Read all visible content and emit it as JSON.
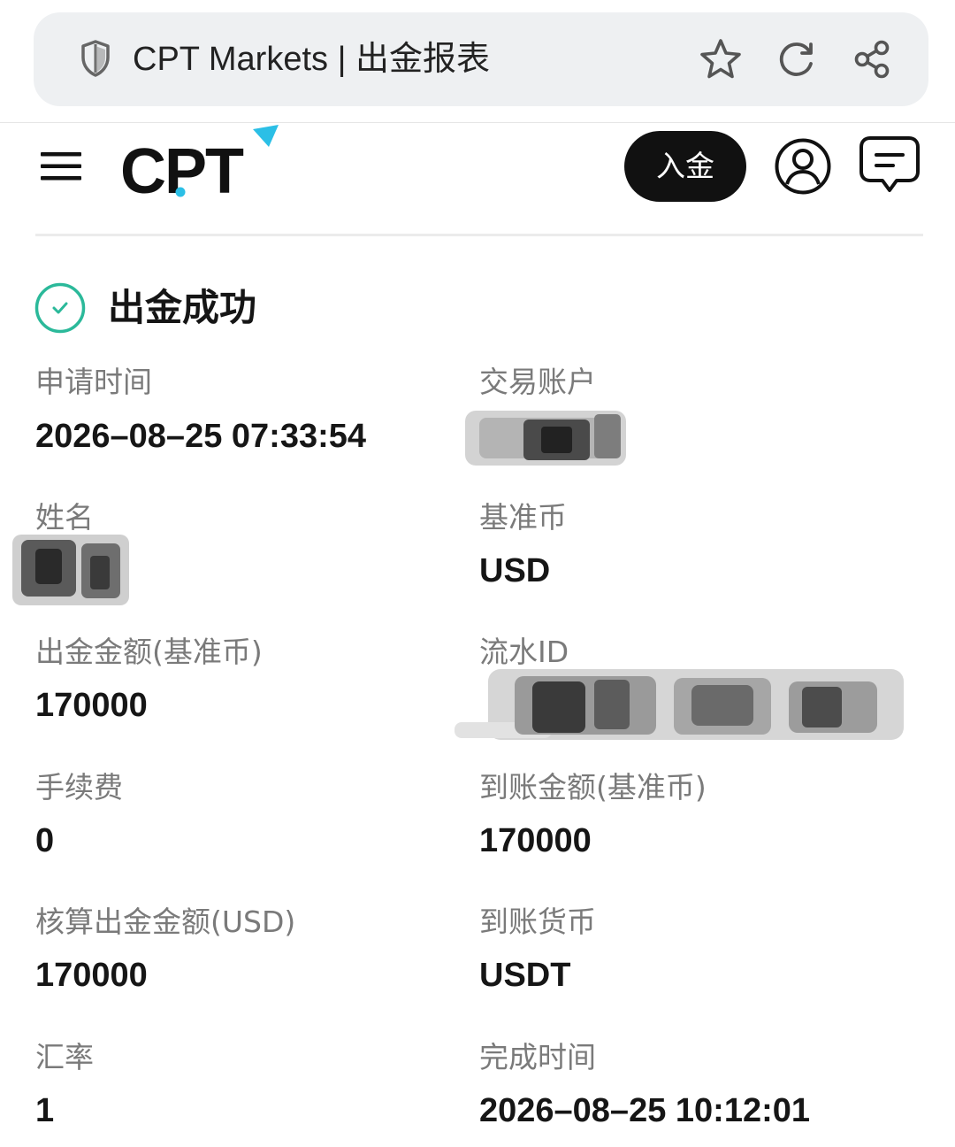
{
  "browser": {
    "title": "CPT Markets | 出金报表",
    "icons": [
      "shield-icon",
      "star-icon",
      "reload-icon",
      "share-icon"
    ]
  },
  "header": {
    "logo": "CPT",
    "deposit_label": "入金",
    "icons": [
      "menu-icon",
      "account-icon",
      "message-icon"
    ],
    "accent_color": "#2bbfe6"
  },
  "status": {
    "title": "出金成功",
    "icon": "check-circle-icon",
    "color": "#2bb99a"
  },
  "details": {
    "apply_time": {
      "label": "申请时间",
      "value": "2026–08–25 07:33:54"
    },
    "trading_account": {
      "label": "交易账户"
    },
    "name": {
      "label": "姓名"
    },
    "base_currency": {
      "label": "基准币",
      "value": "USD"
    },
    "withdraw_amount": {
      "label": "出金金额(基准币)",
      "value": "170000"
    },
    "transaction_id": {
      "label": "流水ID"
    },
    "fee": {
      "label": "手续费",
      "value": "0"
    },
    "received_amount": {
      "label": "到账金额(基准币)",
      "value": "170000"
    },
    "settled_amount": {
      "label": "核算出金金额(USD)",
      "value": "170000"
    },
    "received_currency": {
      "label": "到账货币",
      "value": "USDT"
    },
    "exchange_rate": {
      "label": "汇率",
      "value": "1"
    },
    "complete_time": {
      "label": "完成时间",
      "value": "2026–08–25 10:12:01"
    }
  }
}
